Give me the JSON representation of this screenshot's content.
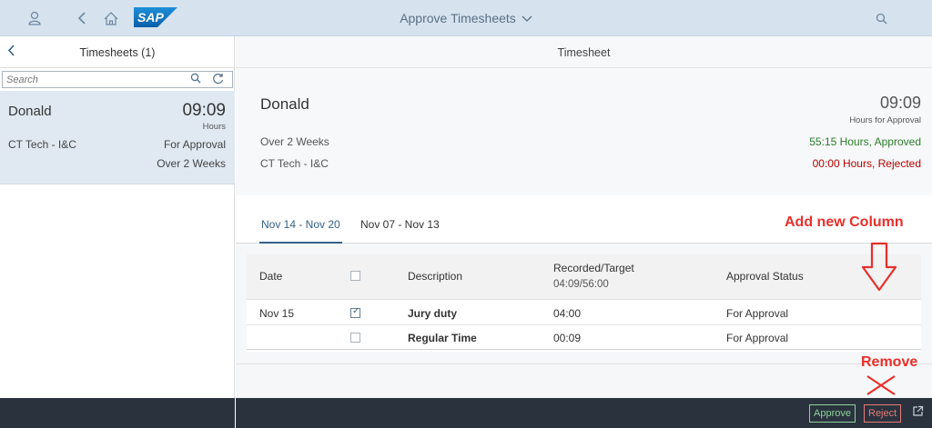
{
  "shell": {
    "title": "Approve Timesheets",
    "logo_text": "SAP",
    "icons": [
      "user-icon",
      "back-icon",
      "home-icon",
      "chevron-down-icon",
      "search-icon"
    ]
  },
  "master": {
    "header_title": "Timesheets (1)",
    "search_placeholder": "Search",
    "items": [
      {
        "name": "Donald",
        "number": "09:09",
        "unit": "Hours",
        "attribute": "CT Tech - I&C",
        "status1": "For Approval",
        "status2": "Over 2 Weeks"
      }
    ]
  },
  "detail": {
    "header_title": "Timesheet",
    "object": {
      "title": "Donald",
      "number": "09:09",
      "unit": "Hours for Approval",
      "attribute1": "Over 2 Weeks",
      "attribute2": "CT Tech - I&C",
      "status_approved": "55:15 Hours, Approved",
      "status_rejected": "00:00 Hours, Rejected"
    },
    "tabs": [
      {
        "label": "Nov 14 - Nov 20",
        "active": true
      },
      {
        "label": "Nov 07 - Nov 13",
        "active": false
      }
    ],
    "table": {
      "columns": {
        "date": "Date",
        "description": "Description",
        "recorded": "Recorded/Target",
        "recorded_value": "04:09/56:00",
        "approval": "Approval Status"
      },
      "rows": [
        {
          "date": "Nov 15",
          "checked": true,
          "description": "Jury duty",
          "recorded": "04:00",
          "status": "For Approval"
        },
        {
          "date": "",
          "checked": false,
          "description": "Regular Time",
          "recorded": "00:09",
          "status": "For Approval"
        }
      ]
    }
  },
  "footer": {
    "approve_label": "Approve",
    "reject_label": "Reject"
  },
  "annotations": {
    "add_column": "Add new Column",
    "remove": "Remove"
  },
  "colors": {
    "shell_bg": "#d6e3ef",
    "accent": "#346187",
    "approved": "#2b7c2b",
    "rejected": "#bb0000",
    "footer_bg": "#2a333d",
    "annotation": "#e8302c"
  }
}
